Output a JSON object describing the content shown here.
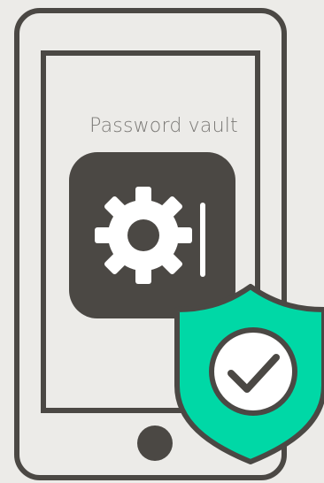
{
  "app": {
    "label": "Password vault"
  },
  "icons": {
    "phone": "smartphone-icon",
    "vault": "gear-vault-icon",
    "shield": "shield-check-icon",
    "home_button": "home-button-icon"
  },
  "colors": {
    "background": "#ecebe8",
    "outline": "#4b4844",
    "vault_fill": "#4b4844",
    "shield_fill": "#00d8a6",
    "check_bg": "#ffffff",
    "label_text": "#7a7875"
  }
}
